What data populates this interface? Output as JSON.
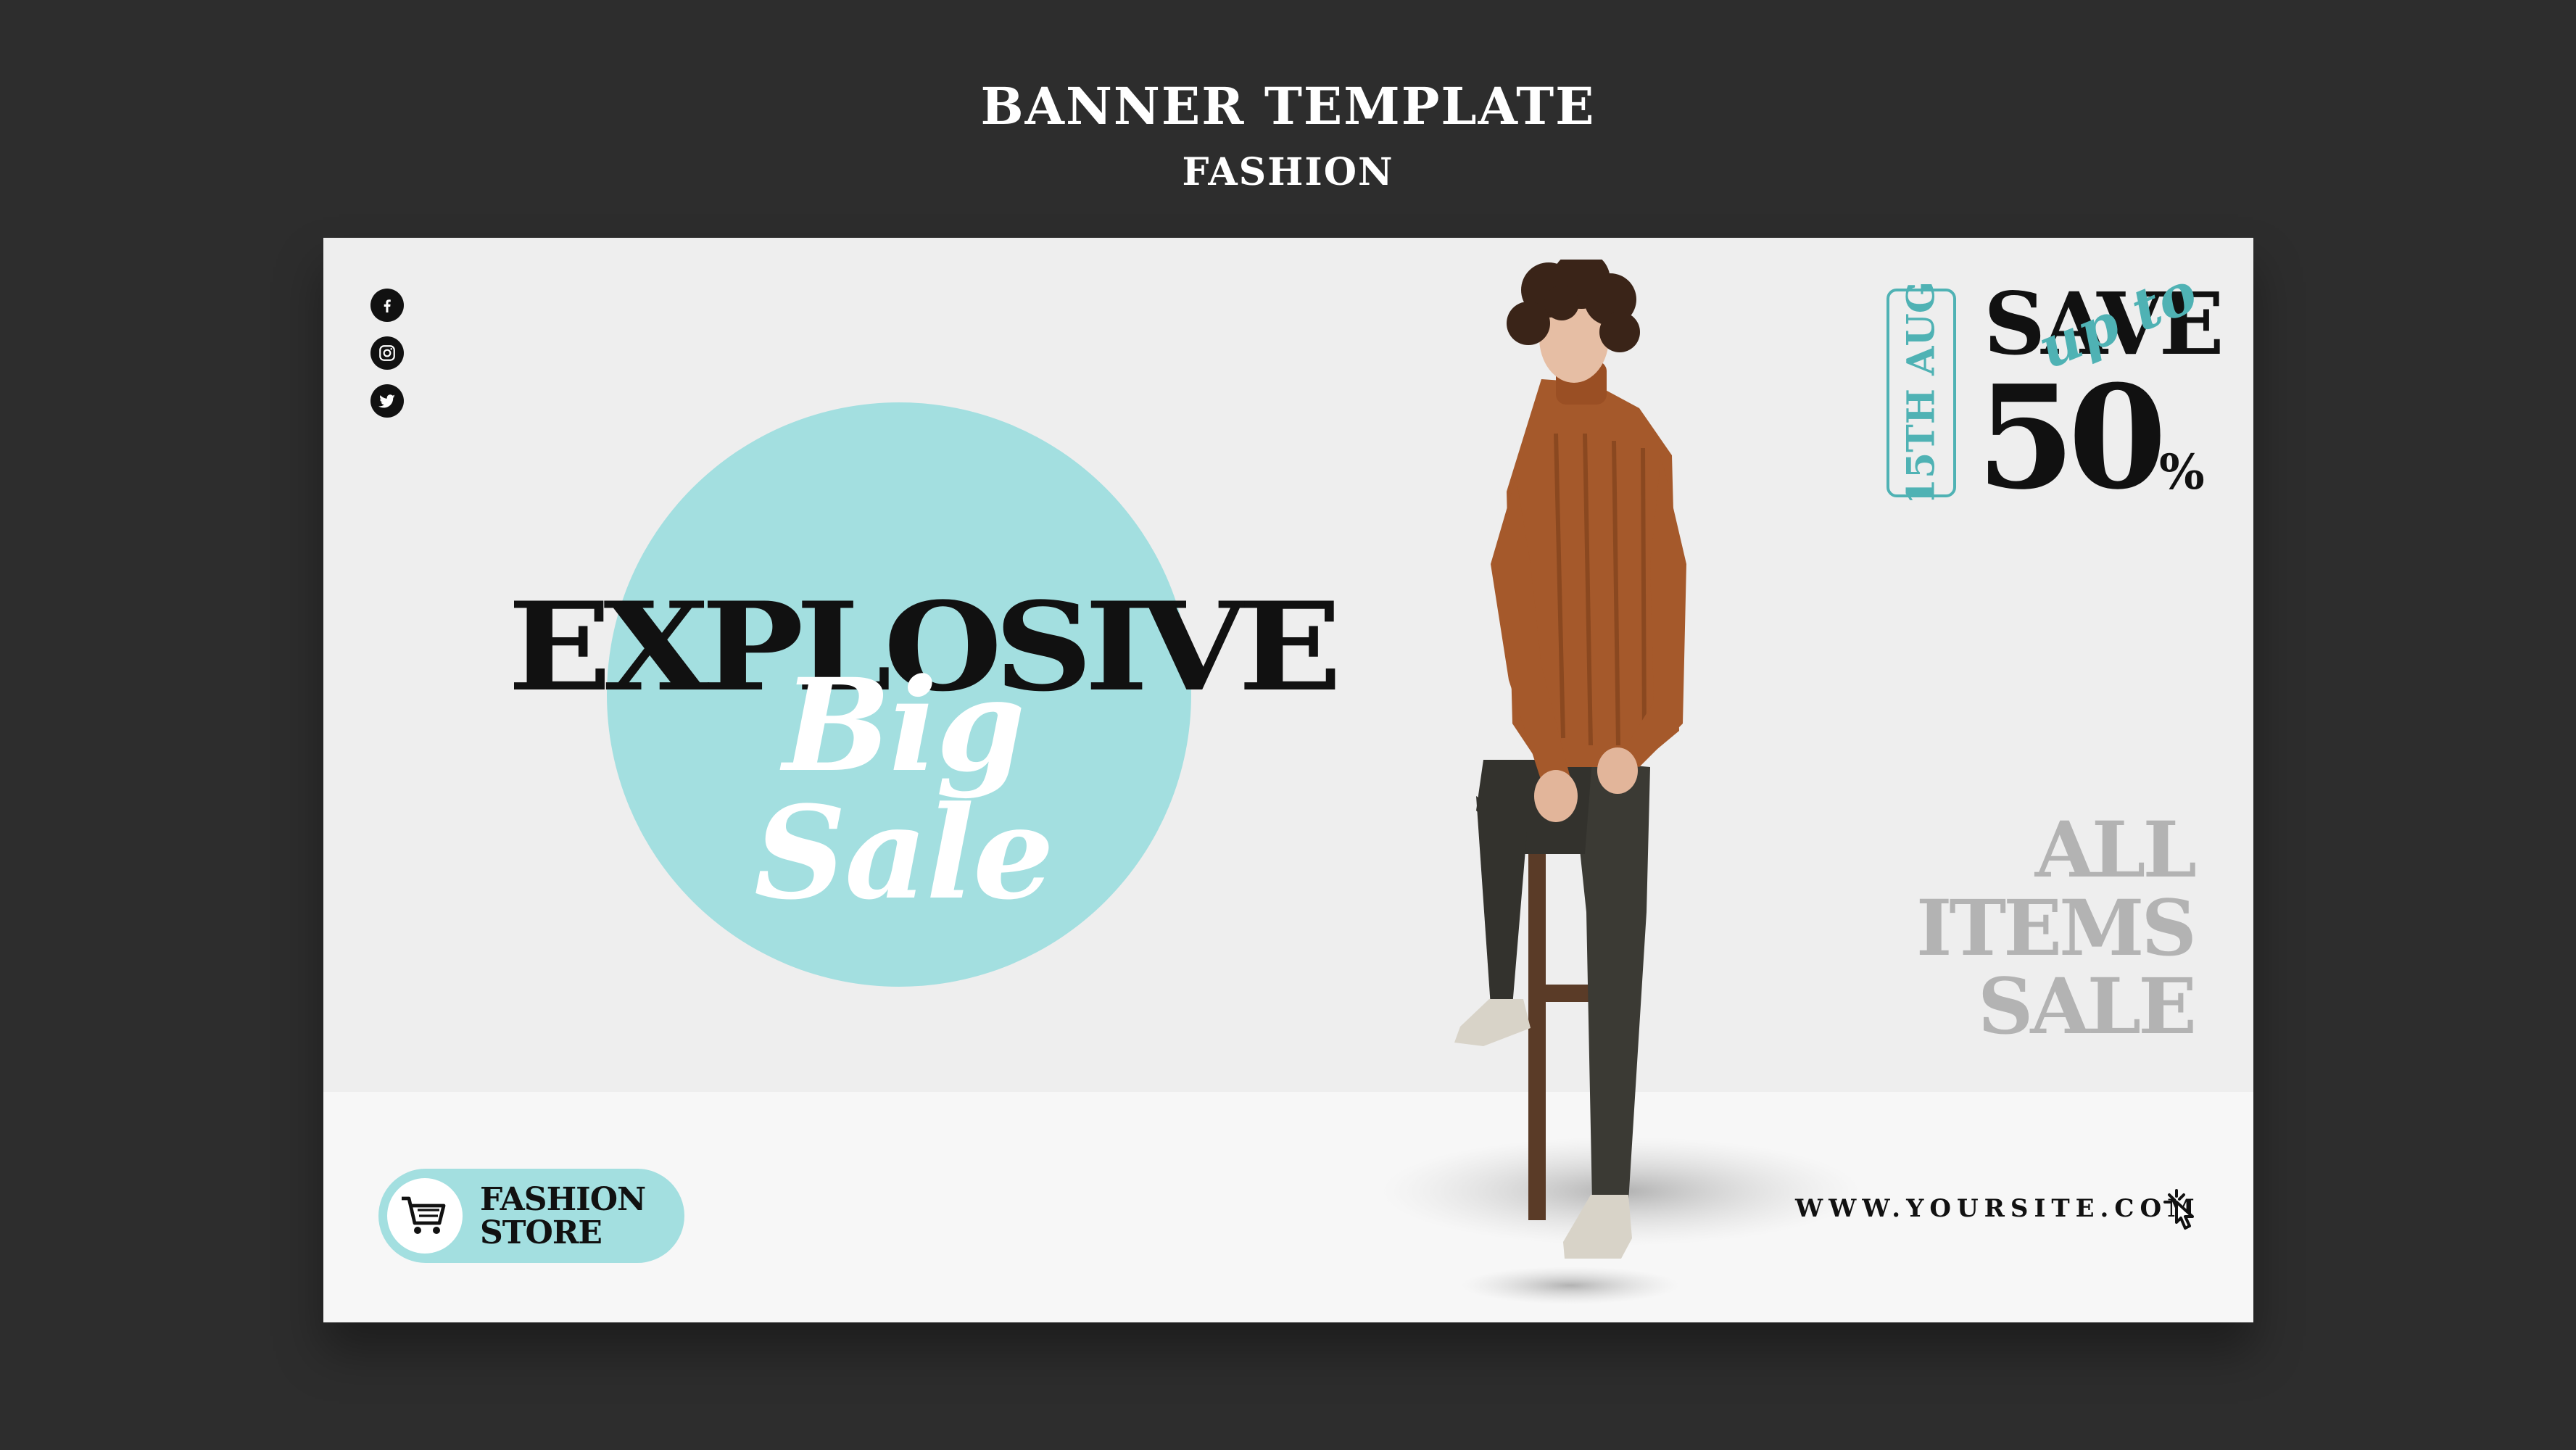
{
  "page": {
    "title": "BANNER TEMPLATE",
    "subtitle": "FASHION"
  },
  "banner": {
    "social_icons": [
      "facebook-icon",
      "instagram-icon",
      "twitter-icon"
    ],
    "headline": "EXPLOSIVE",
    "script_text": "Big Sale",
    "date": "15TH AUG",
    "save": "SAVE",
    "up_to": "up to",
    "percent_value": "50",
    "percent_sign": "%",
    "all_items": [
      "ALL",
      "ITEMS",
      "SALE"
    ],
    "store_line1": "FASHION",
    "store_line2": "STORE",
    "website": "WWW.YOURSITE.COM",
    "colors": {
      "background": "#2d2d2d",
      "banner": "#eeeeee",
      "accent": "#a3dfe0",
      "accent_dark": "#4fb2b4",
      "text": "#111111",
      "muted": "#b3b3b3"
    }
  }
}
